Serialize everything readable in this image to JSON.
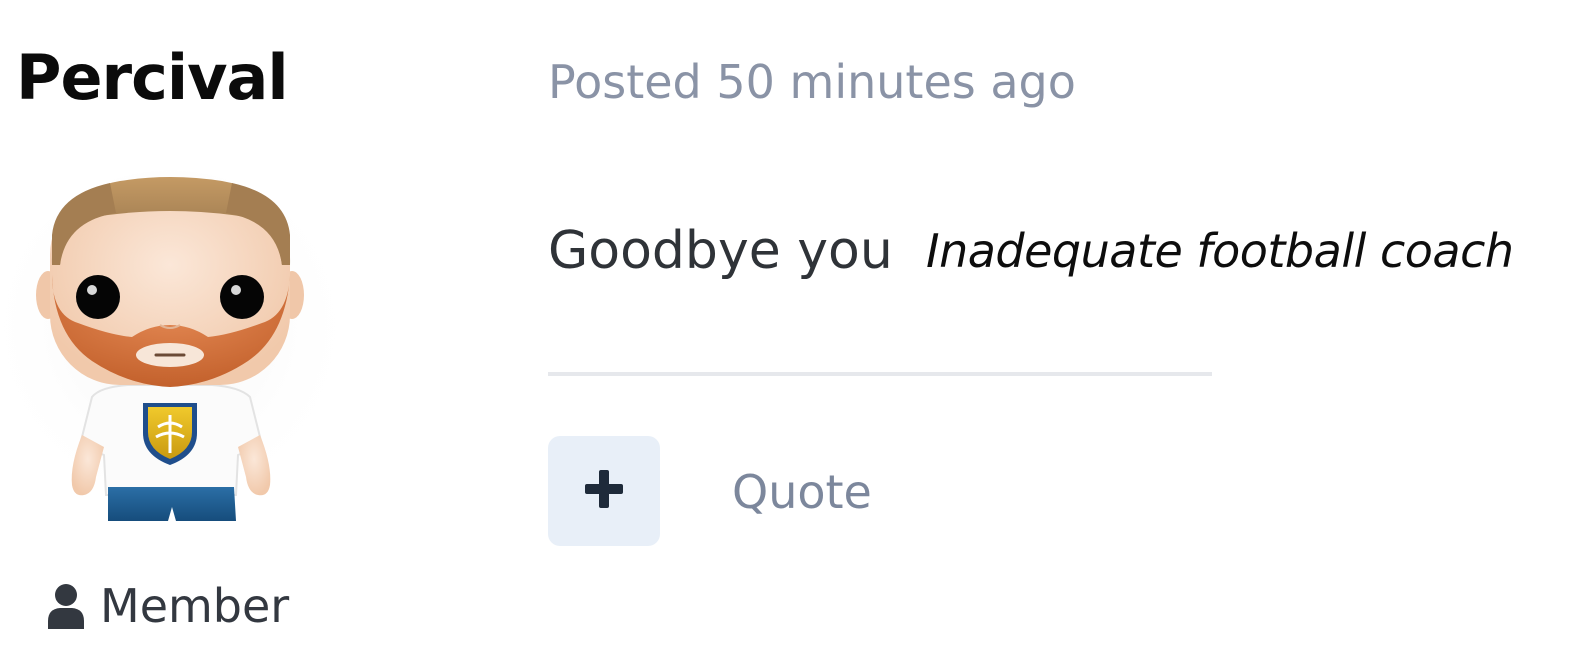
{
  "author": {
    "name": "Percival",
    "role": "Member",
    "role_icon": "user-icon",
    "avatar_icon": "avatar-figure"
  },
  "post": {
    "meta": "Posted 50 minutes ago",
    "body": "Goodbye you",
    "signature": "Inadequate football coach"
  },
  "actions": {
    "react_icon": "plus-icon",
    "quote_label": "Quote"
  },
  "colors": {
    "meta_text": "#8a93a6",
    "react_button_bg": "#e8eff8",
    "react_icon": "#1e2a3a",
    "divider": "#e6e8ec"
  }
}
